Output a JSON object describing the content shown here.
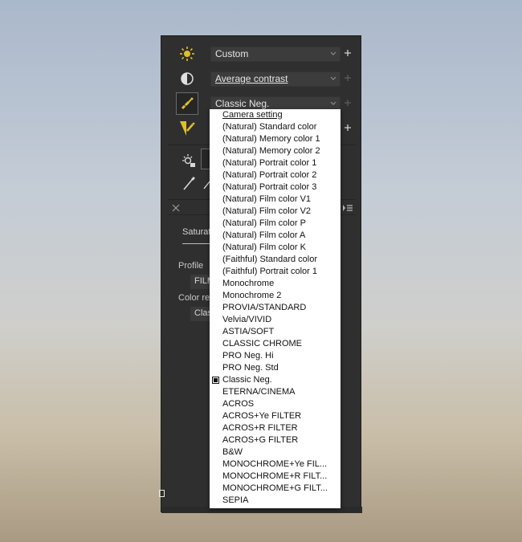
{
  "tone": {
    "label": "Custom",
    "icon": "sun-icon"
  },
  "contrast": {
    "label": "Average contrast",
    "icon": "contrast-icon"
  },
  "film_simulation": {
    "label": "Classic Neg.",
    "icon": "color-wand-icon"
  },
  "tabs": {
    "saturation": "Saturat"
  },
  "profile": {
    "label": "Profile",
    "value": "FILM"
  },
  "color_rendering": {
    "label": "Color re",
    "value": "Clas"
  },
  "dropdown": {
    "selected": "Classic Neg.",
    "items": [
      "Camera setting",
      "(Natural) Standard color",
      "(Natural) Memory color 1",
      "(Natural) Memory color 2",
      "(Natural) Portrait color 1",
      "(Natural) Portrait color 2",
      "(Natural) Portrait color 3",
      "(Natural) Film color V1",
      "(Natural) Film color V2",
      "(Natural) Film color P",
      "(Natural) Film color A",
      "(Natural) Film color K",
      "(Faithful) Standard color",
      "(Faithful) Portrait color 1",
      "Monochrome",
      "Monochrome 2",
      "PROVIA/STANDARD",
      "Velvia/VIVID",
      "ASTIA/SOFT",
      "CLASSIC CHROME",
      "PRO Neg. Hi",
      "PRO Neg. Std",
      "Classic Neg.",
      "ETERNA/CINEMA",
      "ACROS",
      "ACROS+Ye FILTER",
      "ACROS+R FILTER",
      "ACROS+G FILTER",
      "B&W",
      "MONOCHROME+Ye FIL...",
      "MONOCHROME+R FILT...",
      "MONOCHROME+G FILT...",
      "SEPIA"
    ]
  }
}
